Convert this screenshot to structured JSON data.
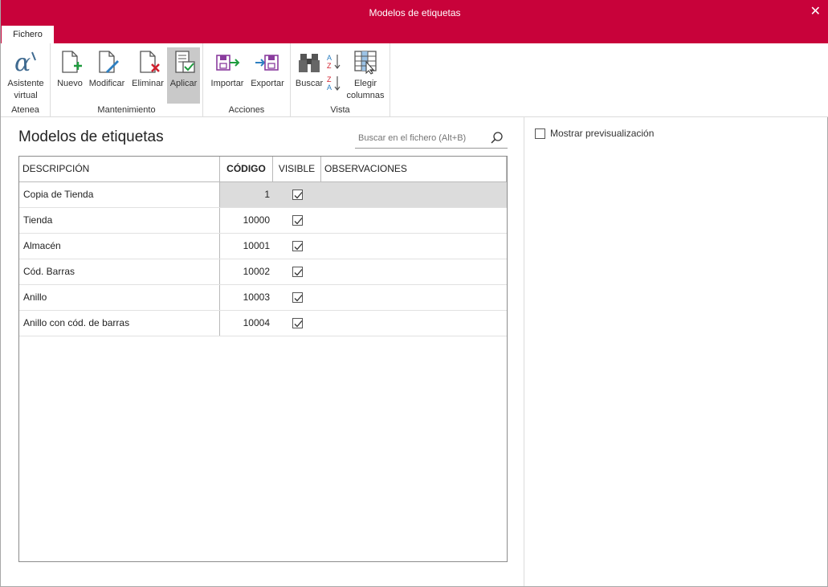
{
  "window": {
    "title": "Modelos de etiquetas",
    "close_icon": "close-icon"
  },
  "tabs": {
    "file": "Fichero"
  },
  "ribbon": {
    "atenea": {
      "label": "Atenea",
      "assistant": {
        "line1": "Asistente",
        "line2": "virtual"
      }
    },
    "mantenimiento": {
      "label": "Mantenimiento",
      "nuevo": "Nuevo",
      "modificar": "Modificar",
      "eliminar": "Eliminar",
      "aplicar": "Aplicar"
    },
    "acciones": {
      "label": "Acciones",
      "importar": "Importar",
      "exportar": "Exportar"
    },
    "vista": {
      "label": "Vista",
      "buscar": "Buscar",
      "elegir": {
        "line1": "Elegir",
        "line2": "columnas"
      }
    }
  },
  "content": {
    "title": "Modelos de etiquetas",
    "search_placeholder": "Buscar en el fichero (Alt+B)"
  },
  "grid": {
    "columns": {
      "descripcion": "DESCRIPCIÓN",
      "codigo": "CÓDIGO",
      "visible": "VISIBLE",
      "observaciones": "OBSERVACIONES"
    },
    "rows": [
      {
        "descripcion": "Copia de Tienda",
        "codigo": "1",
        "visible": true,
        "observaciones": ""
      },
      {
        "descripcion": "Tienda",
        "codigo": "10000",
        "visible": true,
        "observaciones": ""
      },
      {
        "descripcion": "Almacén",
        "codigo": "10001",
        "visible": true,
        "observaciones": ""
      },
      {
        "descripcion": "Cód. Barras",
        "codigo": "10002",
        "visible": true,
        "observaciones": ""
      },
      {
        "descripcion": "Anillo",
        "codigo": "10003",
        "visible": true,
        "observaciones": ""
      },
      {
        "descripcion": "Anillo con cód. de barras",
        "codigo": "10004",
        "visible": true,
        "observaciones": ""
      }
    ]
  },
  "preview": {
    "label": "Mostrar previsualización",
    "checked": false
  },
  "colors": {
    "accent": "#c8023a",
    "selected_row": "#dcdcdc"
  }
}
